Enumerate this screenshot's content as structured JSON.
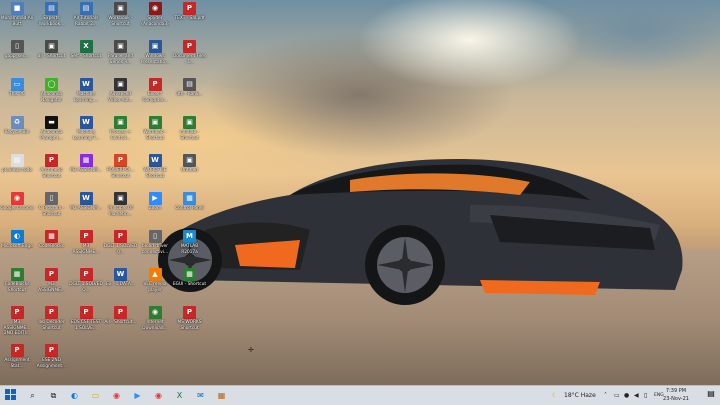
{
  "desktop": {
    "icons": [
      {
        "label": "Muhammad Ali Butt",
        "glyph": "■",
        "color": "#4f7fbf"
      },
      {
        "label": "Experts Workbook...",
        "glyph": "▤",
        "color": "#3a6fb0"
      },
      {
        "label": "All Tutorials Rabbit 2...",
        "glyph": "▤",
        "color": "#3a6fb0"
      },
      {
        "label": "Workbook - Shortcut",
        "glyph": "▣",
        "color": "#4a4a4a"
      },
      {
        "label": "Spyder (Anaconda3)",
        "glyph": "◉",
        "color": "#8b1a1a"
      },
      {
        "label": "TEXT - Sal.pdf",
        "glyph": "P",
        "color": "#c62828"
      },
      {
        "label": "gapp_sec...",
        "glyph": "▯",
        "color": "#555"
      },
      {
        "label": "all - Shortcut",
        "glyph": "▣",
        "color": "#4a4a4a"
      },
      {
        "label": "Self - Shortcut",
        "glyph": "X",
        "color": "#1e7145"
      },
      {
        "label": "Parallel and Series R...",
        "glyph": "▣",
        "color": "#4a4a4a"
      },
      {
        "label": "Windows Presentatio...",
        "glyph": "▣",
        "color": "#2b5797"
      },
      {
        "label": "Document Files - 1...",
        "glyph": "P",
        "color": "#c62828"
      },
      {
        "label": "This PC",
        "glyph": "▭",
        "color": "#3a8dde"
      },
      {
        "label": "Anaconda Navigator",
        "glyph": "◯",
        "color": "#43b02a"
      },
      {
        "label": "Machine Learning ...",
        "glyph": "W",
        "color": "#2b579a"
      },
      {
        "label": "Advanced Video Aut...",
        "glyph": "▣",
        "color": "#333"
      },
      {
        "label": "Excel / Computer...",
        "glyph": "P",
        "color": "#c62828"
      },
      {
        "label": "4th - Rank...",
        "glyph": "▤",
        "color": "#555"
      },
      {
        "label": "Recycle Bin",
        "glyph": "♻",
        "color": "#6b8ebf"
      },
      {
        "label": "Anaconda Prompt (...",
        "glyph": "▬",
        "color": "#111"
      },
      {
        "label": "Machine Learning T...",
        "glyph": "W",
        "color": "#2b579a"
      },
      {
        "label": "Process + Control...",
        "glyph": "▣",
        "color": "#2e7d32"
      },
      {
        "label": "WorldLab - Shortcut",
        "glyph": "▣",
        "color": "#2e7d32"
      },
      {
        "label": "multlab - Shortcut",
        "glyph": "▣",
        "color": "#2e7d32"
      },
      {
        "label": "previous code",
        "glyph": "▤",
        "color": "#ddd"
      },
      {
        "label": "Arithmetic Shortcut",
        "glyph": "P",
        "color": "#c62828"
      },
      {
        "label": "M3 ASSIGNM...",
        "glyph": "▦",
        "color": "#8a2be2"
      },
      {
        "label": "POWERPOI... Shortcut",
        "glyph": "P",
        "color": "#d24726"
      },
      {
        "label": "WORDFILE Shortcut",
        "glyph": "W",
        "color": "#2b579a"
      },
      {
        "label": "Untitled",
        "glyph": "▣",
        "color": "#555"
      },
      {
        "label": "Google Chrome",
        "glyph": "◉",
        "color": "#e53935"
      },
      {
        "label": "C Program - Shortcut",
        "glyph": "▯",
        "color": "#666"
      },
      {
        "label": "M3 ASSIGNM...",
        "glyph": "W",
        "color": "#2b579a"
      },
      {
        "label": "Principle Of Marketin...",
        "glyph": "▣",
        "color": "#333"
      },
      {
        "label": "Zoom",
        "glyph": "▶",
        "color": "#2d8cff"
      },
      {
        "label": "Control Panel",
        "glyph": "▦",
        "color": "#3a8dde"
      },
      {
        "label": "Microsoft Edge",
        "glyph": "◐",
        "color": "#0c7bd6"
      },
      {
        "label": "CodeBlocks",
        "glyph": "▦",
        "color": "#c62828"
      },
      {
        "label": "M3 ASSIGNME...",
        "glyph": "P",
        "color": "#c62828"
      },
      {
        "label": "DGLT 1 SOLVED Q...",
        "glyph": "P",
        "color": "#c62828"
      },
      {
        "label": "blood driver connectivi...",
        "glyph": "▯",
        "color": "#666"
      },
      {
        "label": "MATLAB R2017a",
        "glyph": "M",
        "color": "#1e88c8"
      },
      {
        "label": "CodeBlocks Shortcut",
        "glyph": "▦",
        "color": "#2e7d32"
      },
      {
        "label": "M3 ASSIGNME...",
        "glyph": "P",
        "color": "#c62828"
      },
      {
        "label": "DGLT 1 SOLVED Q...",
        "glyph": "P",
        "color": "#c62828"
      },
      {
        "label": "Ex - 1 DATA...",
        "glyph": "W",
        "color": "#2b579a"
      },
      {
        "label": "VLC media player",
        "glyph": "▲",
        "color": "#f57c00"
      },
      {
        "label": "EGUI - Shortcut",
        "glyph": "▦",
        "color": "#2e7d32"
      },
      {
        "label": "M3 ASSIGNME... 2ND EDITI...",
        "glyph": "P",
        "color": "#c62828"
      },
      {
        "label": "lab Decoder Shortcut",
        "glyph": "P",
        "color": "#c62828"
      },
      {
        "label": "EDS CSF TEST 1 SOLVE...",
        "glyph": "P",
        "color": "#c62828"
      },
      {
        "label": "All - Shortcut...",
        "glyph": "P",
        "color": "#c62828"
      },
      {
        "label": "Internet Download...",
        "glyph": "◉",
        "color": "#2e7d32"
      },
      {
        "label": "MS WORKS Shortcut",
        "glyph": "P",
        "color": "#c62828"
      },
      {
        "label": "Assignment Stat...",
        "glyph": "P",
        "color": "#c62828"
      },
      {
        "label": "ESE 2ND Assignment...",
        "glyph": "P",
        "color": "#c62828"
      }
    ]
  },
  "taskbar": {
    "start_icon": "windows-start-icon",
    "pinned": [
      {
        "name": "search",
        "glyph": "⌕"
      },
      {
        "name": "task-view",
        "glyph": "⧉"
      },
      {
        "name": "edge",
        "glyph": "◐"
      },
      {
        "name": "file-explorer",
        "glyph": "▭"
      },
      {
        "name": "chrome",
        "glyph": "◉"
      },
      {
        "name": "zoom",
        "glyph": "▶"
      },
      {
        "name": "chrome-2",
        "glyph": "◉"
      },
      {
        "name": "excel",
        "glyph": "X"
      },
      {
        "name": "mail",
        "glyph": "✉"
      },
      {
        "name": "apps",
        "glyph": "▦"
      }
    ],
    "weather": "18°C  Haze",
    "time": "7:39 PM",
    "date": "23-Nov-21",
    "language": "ENG"
  }
}
